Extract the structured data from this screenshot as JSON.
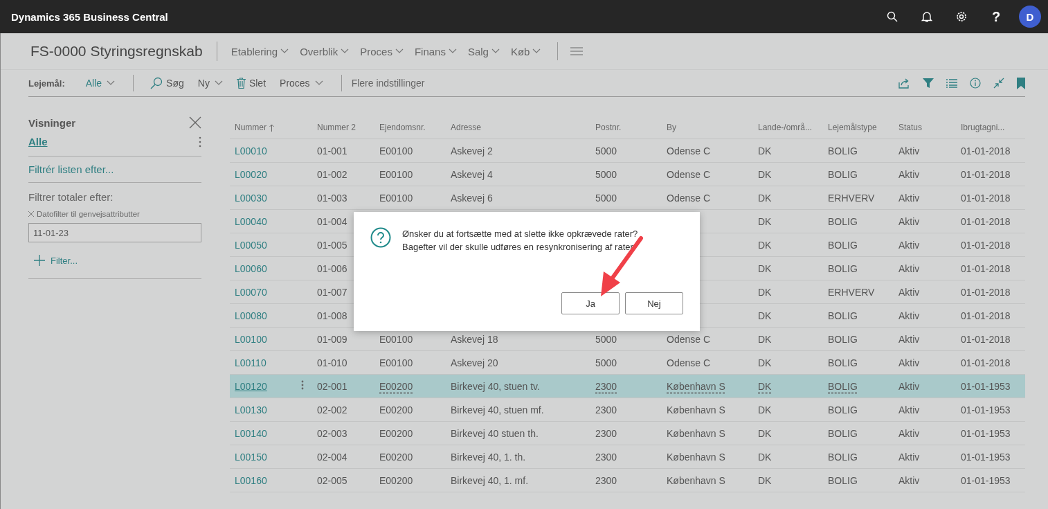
{
  "app_bar": {
    "title": "Dynamics 365 Business Central",
    "help": "?",
    "avatar": "D"
  },
  "page": {
    "title": "FS-0000 Styringsregnskab",
    "nav": [
      {
        "label": "Etablering"
      },
      {
        "label": "Overblik"
      },
      {
        "label": "Proces"
      },
      {
        "label": "Finans"
      },
      {
        "label": "Salg"
      },
      {
        "label": "Køb"
      }
    ]
  },
  "toolbar": {
    "filter_label": "Lejemål:",
    "filter_value": "Alle",
    "actions": [
      {
        "label": "Søg",
        "kind": "search"
      },
      {
        "label": "Ny",
        "kind": "dropdown"
      },
      {
        "label": "Slet",
        "kind": "delete"
      },
      {
        "label": "Proces",
        "kind": "dropdown"
      }
    ],
    "more": "Flere indstillinger"
  },
  "sidebar": {
    "title": "Visninger",
    "views": [
      {
        "label": "Alle",
        "selected": true
      }
    ],
    "filter_list": "Filtrér listen efter...",
    "totals_label": "Filtrer totaler efter:",
    "date_filter_label": "Datofilter til genvejsattributter",
    "date_filter_value": "11-01-23",
    "add_filter": "Filter..."
  },
  "table": {
    "columns": [
      {
        "label": "Nummer",
        "sorted": true
      },
      {
        "label": "Nummer 2",
        "sorted": false
      },
      {
        "label": "Ejendomsnr.",
        "sorted": false
      },
      {
        "label": "Adresse",
        "sorted": false
      },
      {
        "label": "Postnr.",
        "sorted": false
      },
      {
        "label": "By",
        "sorted": false
      },
      {
        "label": "Lande-/områ...",
        "sorted": false
      },
      {
        "label": "Lejemålstype",
        "sorted": false
      },
      {
        "label": "Status",
        "sorted": false
      },
      {
        "label": "Ibrugtagni...",
        "sorted": false
      }
    ],
    "rows": [
      {
        "selected": false,
        "cells": [
          "L00010",
          "01-001",
          "E00100",
          "Askevej 2",
          "5000",
          "Odense C",
          "DK",
          "BOLIG",
          "Aktiv",
          "01-01-2018"
        ]
      },
      {
        "selected": false,
        "cells": [
          "L00020",
          "01-002",
          "E00100",
          "Askevej 4",
          "5000",
          "Odense C",
          "DK",
          "BOLIG",
          "Aktiv",
          "01-01-2018"
        ]
      },
      {
        "selected": false,
        "cells": [
          "L00030",
          "01-003",
          "E00100",
          "Askevej 6",
          "5000",
          "Odense C",
          "DK",
          "ERHVERV",
          "Aktiv",
          "01-01-2018"
        ]
      },
      {
        "selected": false,
        "cells": [
          "L00040",
          "01-004",
          null,
          null,
          null,
          null,
          "DK",
          "BOLIG",
          "Aktiv",
          "01-01-2018"
        ]
      },
      {
        "selected": false,
        "cells": [
          "L00050",
          "01-005",
          null,
          null,
          null,
          null,
          "DK",
          "BOLIG",
          "Aktiv",
          "01-01-2018"
        ]
      },
      {
        "selected": false,
        "cells": [
          "L00060",
          "01-006",
          null,
          null,
          null,
          null,
          "DK",
          "BOLIG",
          "Aktiv",
          "01-01-2018"
        ]
      },
      {
        "selected": false,
        "cells": [
          "L00070",
          "01-007",
          null,
          null,
          null,
          null,
          "DK",
          "ERHVERV",
          "Aktiv",
          "01-01-2018"
        ]
      },
      {
        "selected": false,
        "cells": [
          "L00080",
          "01-008",
          null,
          null,
          null,
          null,
          "DK",
          "BOLIG",
          "Aktiv",
          "01-01-2018"
        ]
      },
      {
        "selected": false,
        "cells": [
          "L00100",
          "01-009",
          "E00100",
          "Askevej 18",
          "5000",
          "Odense C",
          "DK",
          "BOLIG",
          "Aktiv",
          "01-01-2018"
        ]
      },
      {
        "selected": false,
        "cells": [
          "L00110",
          "01-010",
          "E00100",
          "Askevej 20",
          "5000",
          "Odense C",
          "DK",
          "BOLIG",
          "Aktiv",
          "01-01-2018"
        ]
      },
      {
        "selected": true,
        "cells": [
          "L00120",
          "02-001",
          "E00200",
          "Birkevej 40, stuen tv.",
          "2300",
          "København S",
          "DK",
          "BOLIG",
          "Aktiv",
          "01-01-1953"
        ]
      },
      {
        "selected": false,
        "cells": [
          "L00130",
          "02-002",
          "E00200",
          "Birkevej 40, stuen mf.",
          "2300",
          "København S",
          "DK",
          "BOLIG",
          "Aktiv",
          "01-01-1953"
        ]
      },
      {
        "selected": false,
        "cells": [
          "L00140",
          "02-003",
          "E00200",
          "Birkevej 40 stuen th.",
          "2300",
          "København S",
          "DK",
          "BOLIG",
          "Aktiv",
          "01-01-1953"
        ]
      },
      {
        "selected": false,
        "cells": [
          "L00150",
          "02-004",
          "E00200",
          "Birkevej 40, 1. th.",
          "2300",
          "København S",
          "DK",
          "BOLIG",
          "Aktiv",
          "01-01-1953"
        ]
      },
      {
        "selected": false,
        "cells": [
          "L00160",
          "02-005",
          "E00200",
          "Birkevej 40, 1. mf.",
          "2300",
          "København S",
          "DK",
          "BOLIG",
          "Aktiv",
          "01-01-1953"
        ]
      }
    ]
  },
  "dialog": {
    "message_lines": [
      "Ønsker du at fortsætte med at slette ikke opkrævede rater?",
      "Bagefter vil der skulle udføres en resynkronisering af rater."
    ],
    "buttons": [
      {
        "label": "Ja"
      },
      {
        "label": "Nej"
      }
    ]
  }
}
